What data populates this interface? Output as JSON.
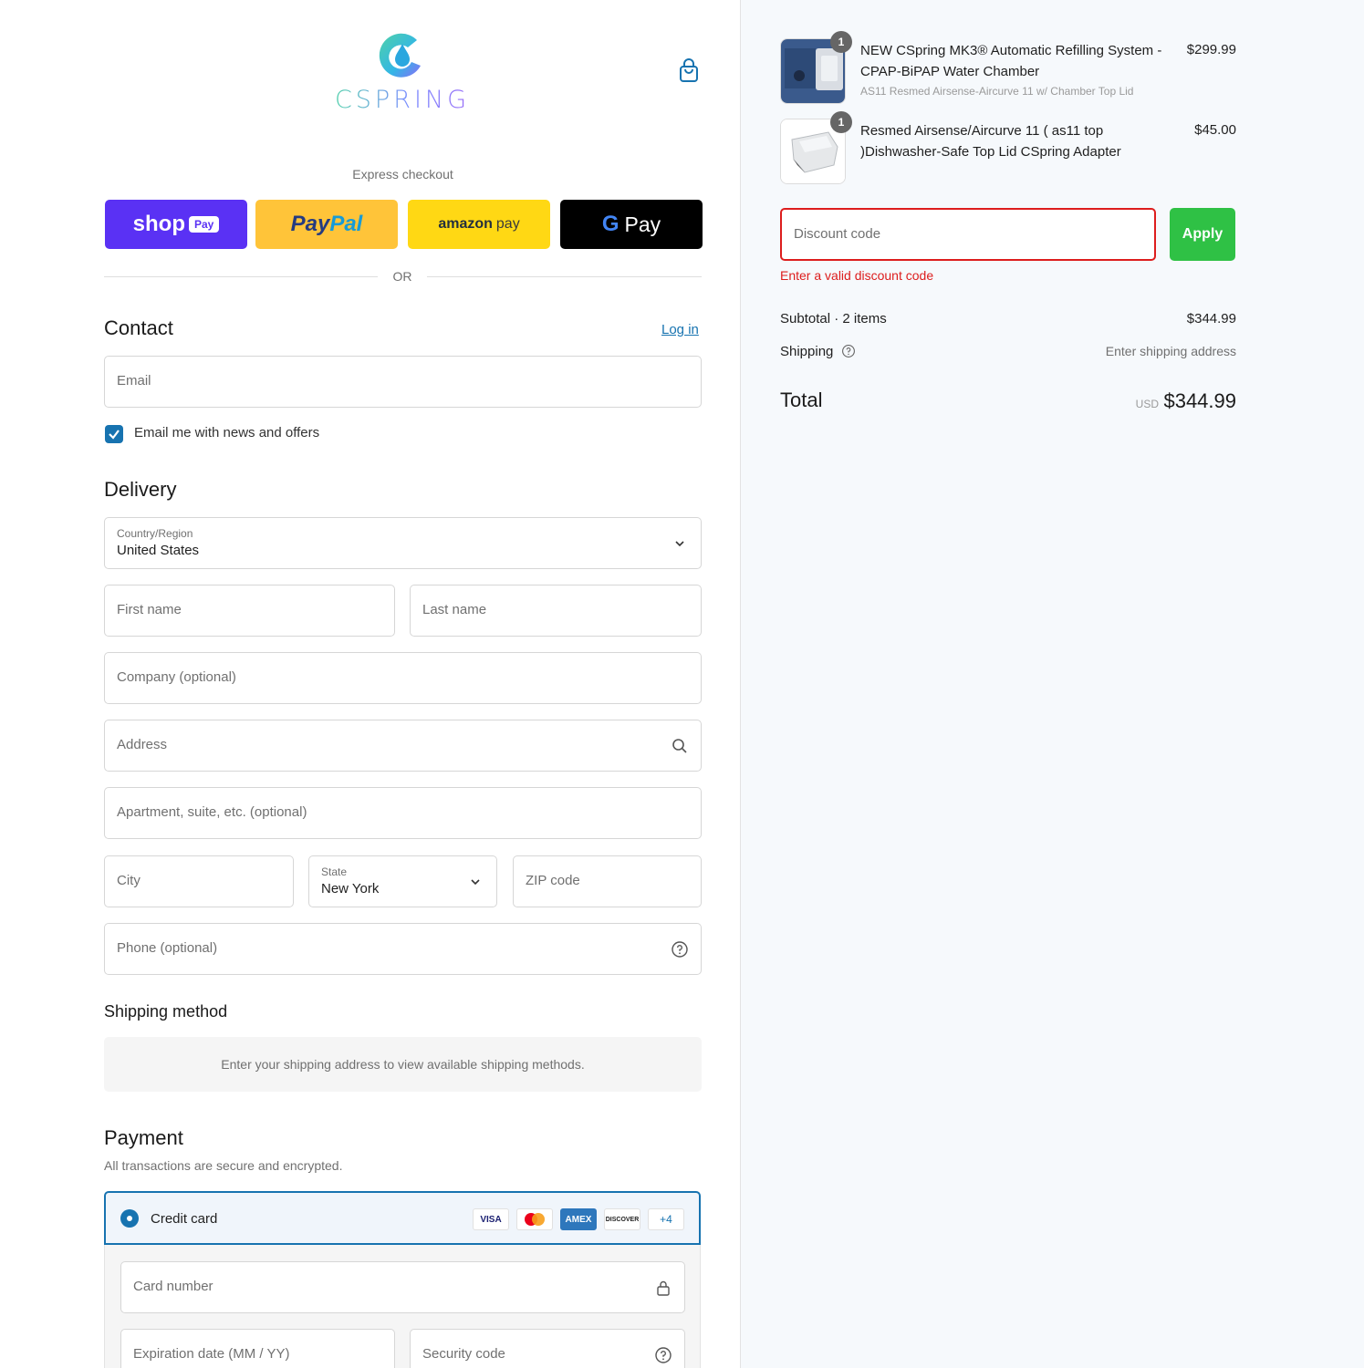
{
  "brand": {
    "name": "CSPRING",
    "colors": {
      "primary": "#1773b0",
      "error": "#dd1d1d",
      "apply": "#2fc145"
    }
  },
  "header": {
    "cart_icon": "shopping-bag-icon"
  },
  "express": {
    "label": "Express checkout",
    "buttons": {
      "shop_pay": {
        "text": "shop",
        "pill": "Pay"
      },
      "paypal": {
        "part1": "Pay",
        "part2": "Pal"
      },
      "amazon_pay": {
        "part1": "amazon",
        "part2": "pay"
      },
      "google_pay": {
        "g": "G",
        "text": "Pay"
      }
    },
    "or_text": "OR"
  },
  "contact": {
    "title": "Contact",
    "login_link": "Log in",
    "email_placeholder": "Email",
    "newsletter_label": "Email me with news and offers",
    "newsletter_checked": true
  },
  "delivery": {
    "title": "Delivery",
    "country_label": "Country/Region",
    "country_value": "United States",
    "first_name_placeholder": "First name",
    "last_name_placeholder": "Last name",
    "company_placeholder": "Company (optional)",
    "address_placeholder": "Address",
    "apartment_placeholder": "Apartment, suite, etc. (optional)",
    "city_placeholder": "City",
    "state_label": "State",
    "state_value": "New York",
    "zip_placeholder": "ZIP code",
    "phone_placeholder": "Phone (optional)"
  },
  "shipping_method": {
    "title": "Shipping method",
    "info": "Enter your shipping address to view available shipping methods."
  },
  "payment": {
    "title": "Payment",
    "subtitle": "All transactions are secure and encrypted.",
    "method_label": "Credit card",
    "card_logos": {
      "visa": "VISA",
      "amex": "AMEX",
      "discover": "DISCOVER",
      "more": "+4"
    },
    "card_number_placeholder": "Card number",
    "expiration_placeholder": "Expiration date (MM / YY)",
    "security_code_placeholder": "Security code"
  },
  "order_summary": {
    "items": [
      {
        "name": "NEW CSpring MK3® Automatic Refilling System - CPAP-BiPAP Water Chamber",
        "variant": "AS11 Resmed Airsense-Aircurve 11 w/ Chamber Top Lid",
        "price": "$299.99",
        "quantity": "1"
      },
      {
        "name": "Resmed Airsense/Aircurve 11 ( as11 top )Dishwasher-Safe Top Lid CSpring Adapter",
        "variant": "",
        "price": "$45.00",
        "quantity": "1"
      }
    ],
    "discount_placeholder": "Discount code",
    "apply_label": "Apply",
    "discount_error": "Enter a valid discount code",
    "subtotal_label": "Subtotal · 2 items",
    "subtotal_value": "$344.99",
    "shipping_label": "Shipping",
    "shipping_value": "Enter shipping address",
    "total_label": "Total",
    "total_currency": "USD",
    "total_value": "$344.99"
  }
}
